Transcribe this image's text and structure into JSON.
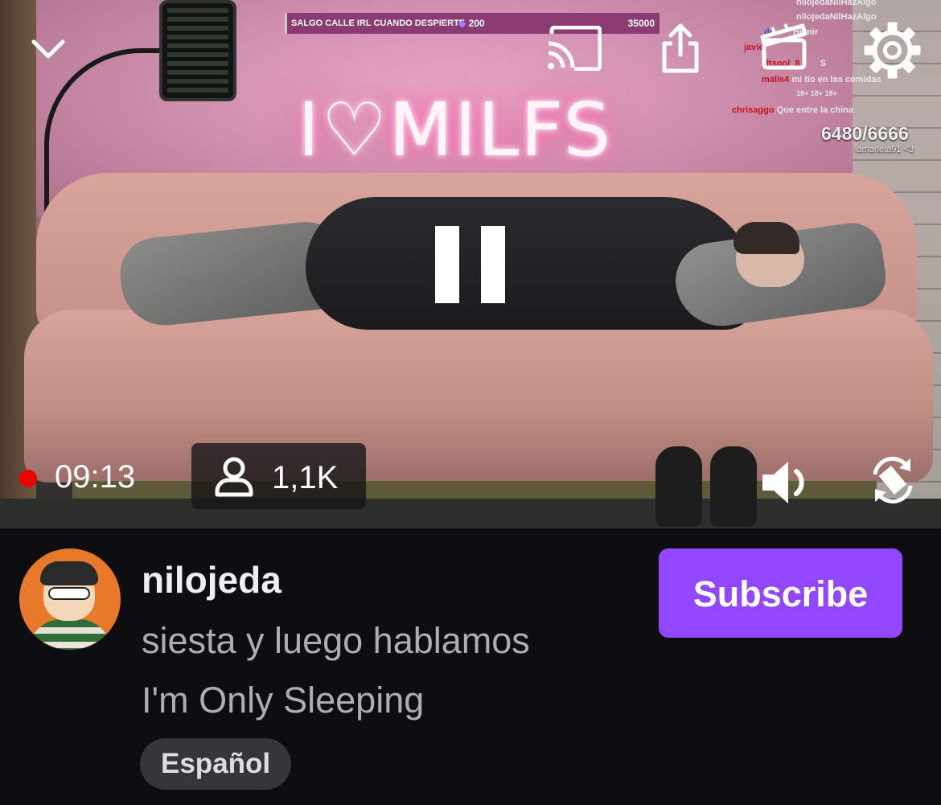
{
  "stream_overlay": {
    "goal_title": "SALGO CALLE IRL CUANDO DESPIERTE",
    "goal_current": "200",
    "goal_target": "35000",
    "counter": "6480/6666",
    "counter_sub": "lamarieta91 <3",
    "chat": [
      {
        "user": "",
        "message": "nilojedaNilHazAlgo"
      },
      {
        "user": "",
        "message": "nilojedaNilHazAlgo"
      },
      {
        "user": "dr",
        "message": "Hilmir"
      },
      {
        "user": "javie",
        "message": ""
      },
      {
        "user": "ltsool_8",
        "message": "S"
      },
      {
        "user": "malis4",
        "message": "mi tio en las comidas"
      },
      {
        "user": "",
        "message": "18+ 18+ 18+"
      },
      {
        "user": "chrisaggo",
        "message": "Que entre la china"
      }
    ]
  },
  "sign_text": "I♡MILFS",
  "player": {
    "live_time": "09:13",
    "viewers": "1,1K"
  },
  "channel": {
    "name": "nilojeda",
    "stream_title": "siesta y luego hablamos",
    "category": "I'm Only Sleeping",
    "tag": "Español",
    "subscribe_label": "Subscribe"
  },
  "colors": {
    "accent": "#9147ff",
    "live": "#eb0400",
    "background": "#0e0e10"
  },
  "icons": [
    "chevron-down-icon",
    "cast-icon",
    "share-icon",
    "clip-icon",
    "settings-icon",
    "pause-icon",
    "viewers-icon",
    "volume-icon",
    "rotate-icon"
  ]
}
